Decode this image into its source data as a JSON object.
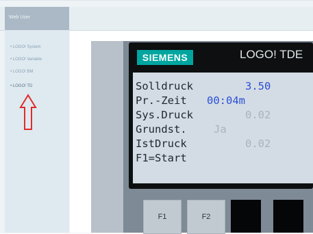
{
  "sidebar": {
    "title": "Web User",
    "items": [
      {
        "label": "• LOGO! System"
      },
      {
        "label": "• LOGO! Variable"
      },
      {
        "label": "• LOGO! BM"
      },
      {
        "label": "• LOGO! TD"
      }
    ]
  },
  "device": {
    "brand": "SIEMENS",
    "model": "LOGO! TDE",
    "lcd_rows": [
      {
        "label": "Solldruck",
        "value": "3.50",
        "value_style": "blue"
      },
      {
        "label": "Pr.-Zeit",
        "value": "00:04m",
        "value_style": "blue"
      },
      {
        "label": "Sys.Druck",
        "value": "0.02",
        "value_style": "grey"
      },
      {
        "label": "Grundst.",
        "value": "Ja",
        "value_style": "grey"
      },
      {
        "label": "IstDruck",
        "value": "0.02",
        "value_style": "grey"
      },
      {
        "label": "F1=Start",
        "value": "",
        "value_style": "none"
      }
    ],
    "keys": [
      "F1",
      "F2"
    ]
  },
  "colors": {
    "brand_teal": "#00a5a0",
    "lcd_background": "#d3dce4",
    "value_blue": "#2c4fd6",
    "annotation_red": "#e02a2a"
  },
  "icons": {
    "annotation": "up-arrow-outline-icon"
  }
}
